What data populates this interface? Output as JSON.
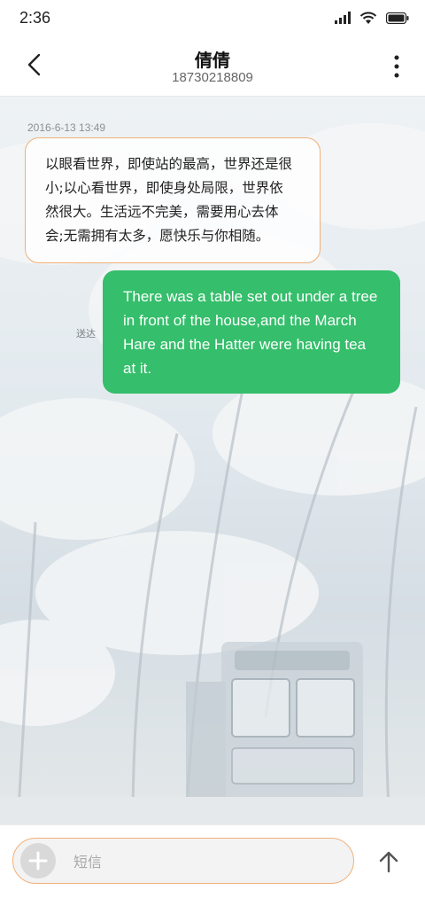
{
  "status_bar": {
    "time": "2:36",
    "icons": [
      "signal-icon",
      "wifi-icon",
      "battery-icon"
    ]
  },
  "header": {
    "contact_name": "倩倩",
    "contact_number": "18730218809",
    "back_icon": "back-arrow-icon",
    "menu_icon": "more-vertical-icon"
  },
  "conversation": {
    "timestamp": "2016-6-13 13:49",
    "messages": [
      {
        "direction": "incoming",
        "lines": [
          "以眼看世界，即使站的最高，世界还是很",
          "小;以心看世界，即使身处局限，世界依",
          "然很大。生活远不完美，需要用心去体",
          "会;无需拥有太多，愿快乐与你相随。"
        ]
      },
      {
        "direction": "outgoing",
        "lines": [
          "There was a table set out under a tree",
          "in front of the house,and the March",
          "Hare and the Hatter were having tea",
          "at it."
        ],
        "status": "送达"
      }
    ]
  },
  "composer": {
    "placeholder": "短信",
    "add_icon": "plus-icon",
    "send_icon": "send-arrow-icon"
  },
  "colors": {
    "outgoing_bubble": "#35be6b",
    "incoming_border": "#f0b078",
    "input_border": "#f0b078"
  }
}
